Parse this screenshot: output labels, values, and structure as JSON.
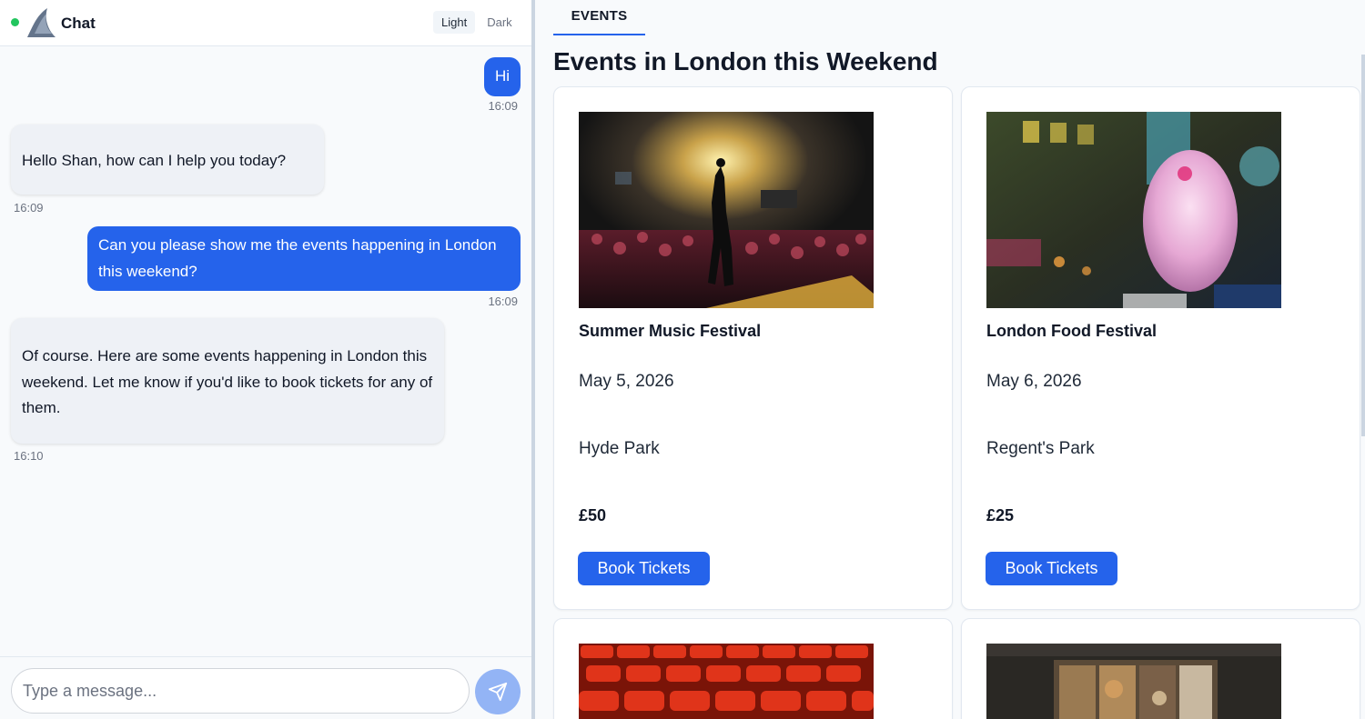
{
  "chat": {
    "title": "Chat",
    "logo_icon": "shark-fin-logo",
    "status_color": "#22c55e",
    "theme_options": [
      "Light",
      "Dark"
    ],
    "theme_selected": "Light",
    "messages": [
      {
        "role": "user",
        "text": "Hi",
        "time": "16:09"
      },
      {
        "role": "bot",
        "text": "Hello Shan, how can I help you today?",
        "time": "16:09"
      },
      {
        "role": "user",
        "text": "Can you please show me the events happening in London this weekend?",
        "time": "16:09"
      },
      {
        "role": "bot",
        "text": "Of course. Here are some events happening in London this weekend. Let me know if you'd like to book tickets for any of them.",
        "time": "16:10"
      }
    ],
    "input": {
      "value": "",
      "placeholder": "Type a message..."
    },
    "send_icon": "paper-plane-icon"
  },
  "events": {
    "tab_label": "EVENTS",
    "heading": "Events in London this Weekend",
    "accent_color": "#2563eb",
    "cards": [
      {
        "name": "Summer Music Festival",
        "date": "May 5, 2026",
        "venue": "Hyde Park",
        "price": "£50",
        "button": "Book Tickets",
        "image": "concert-crowd-photo"
      },
      {
        "name": "London Food Festival",
        "date": "May 6, 2026",
        "venue": "Regent's Park",
        "price": "£25",
        "button": "Book Tickets",
        "image": "cotton-candy-photo"
      },
      {
        "image": "theatre-seats-photo"
      },
      {
        "image": "art-gallery-photo"
      }
    ]
  }
}
